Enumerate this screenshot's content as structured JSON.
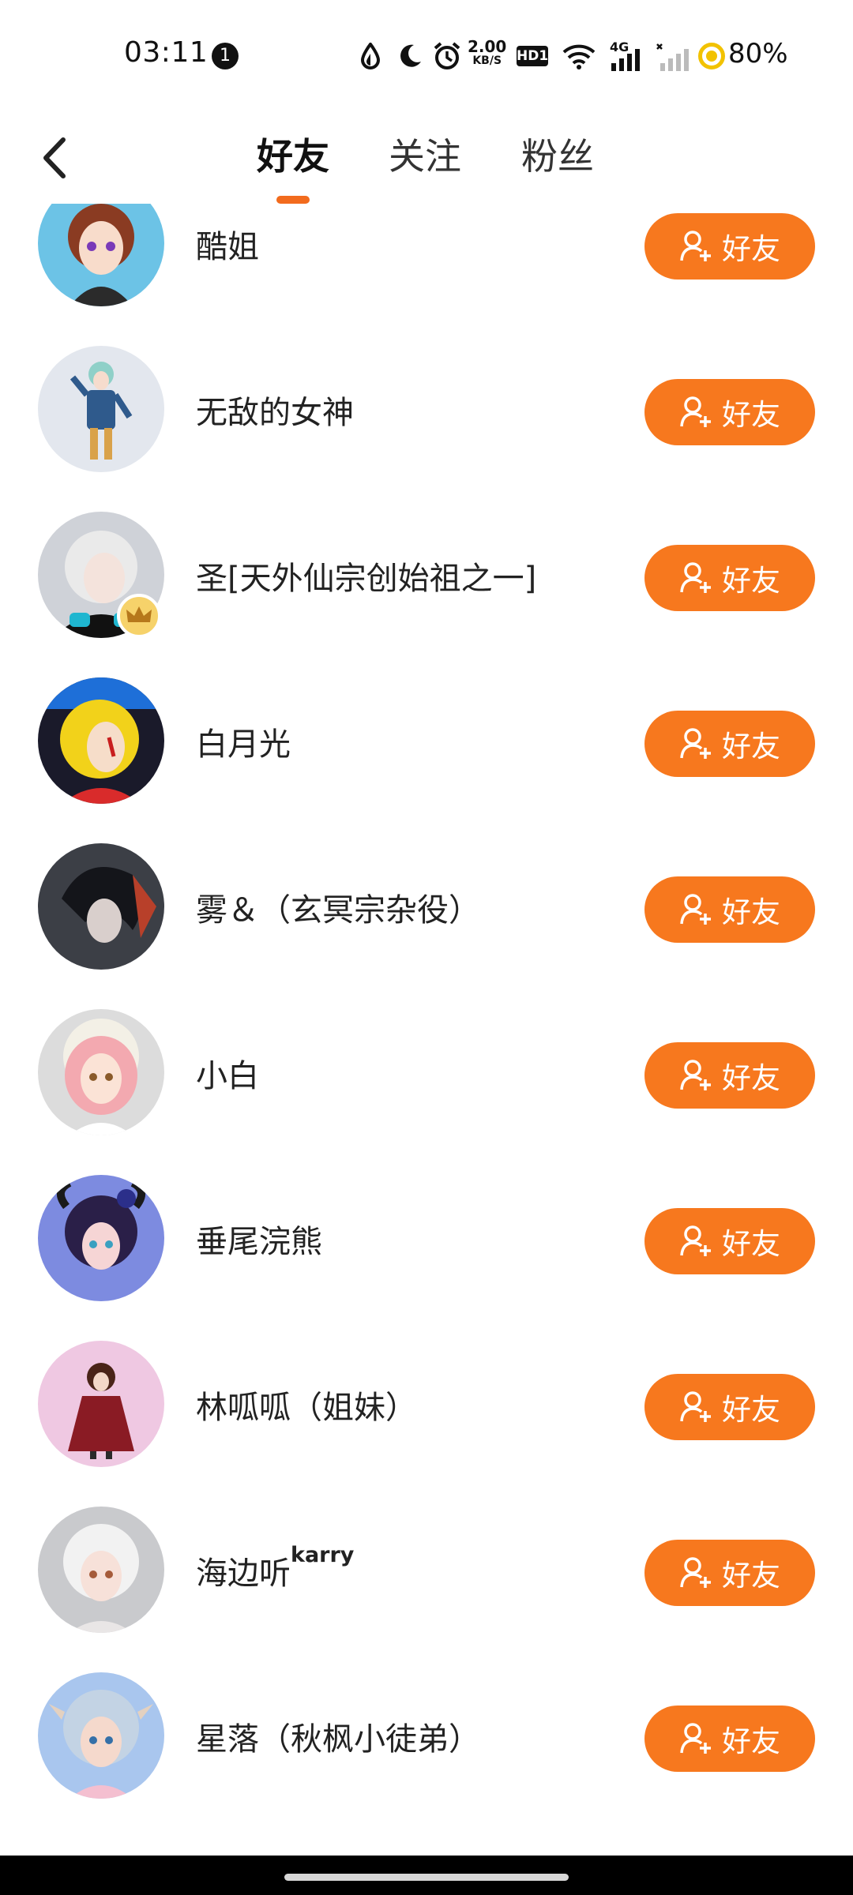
{
  "status_bar": {
    "time": "03:11",
    "notification_count": "1",
    "speed_value": "2.00",
    "speed_unit": "KB/S",
    "hd_label": "HD1",
    "network_label": "4G",
    "battery": "80%"
  },
  "nav": {
    "tabs": [
      {
        "label": "好友",
        "active": true
      },
      {
        "label": "关注",
        "active": false
      },
      {
        "label": "粉丝",
        "active": false
      }
    ]
  },
  "colors": {
    "accent": "#f7781e",
    "indicator": "#f26b1d"
  },
  "friends": [
    {
      "name": "酷姐",
      "button_label": "好友"
    },
    {
      "name": "无敌的女神",
      "button_label": "好友"
    },
    {
      "name": "圣[天外仙宗创始祖之一]",
      "button_label": "好友"
    },
    {
      "name": "白月光",
      "button_label": "好友"
    },
    {
      "name": "雾＆（玄冥宗杂役）",
      "button_label": "好友"
    },
    {
      "name": "小白",
      "button_label": "好友"
    },
    {
      "name": "垂尾浣熊",
      "button_label": "好友"
    },
    {
      "name": "林呱呱（姐妹）",
      "button_label": "好友"
    },
    {
      "name": "海边听",
      "name_sup": "karry",
      "button_label": "好友"
    },
    {
      "name": "星落（秋枫小徒弟）",
      "button_label": "好友"
    }
  ]
}
